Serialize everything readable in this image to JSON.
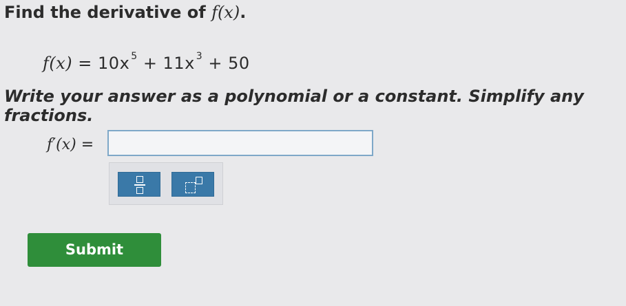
{
  "question": {
    "prompt_text": "Find the derivative of ",
    "prompt_function": "f(x)",
    "prompt_end": ".",
    "equation_lhs": "f(x)",
    "equation_part1": " = 10x",
    "exponent1": "5",
    "equation_part2": " + 11x",
    "exponent2": "3",
    "equation_part3": " + 50",
    "instructions": "Write your answer as a polynomial or a constant. Simplify any fractions."
  },
  "answer": {
    "label_function": "f′(x)",
    "label_equals": " =",
    "value": ""
  },
  "toolbar": {
    "tools": [
      "fraction-icon",
      "exponent-icon"
    ]
  },
  "actions": {
    "submit_label": "Submit"
  },
  "colors": {
    "background": "#e9e9eb",
    "tool_button": "#3a79a8",
    "submit_button": "#2f8e3a",
    "input_border": "#7ea8c8"
  }
}
